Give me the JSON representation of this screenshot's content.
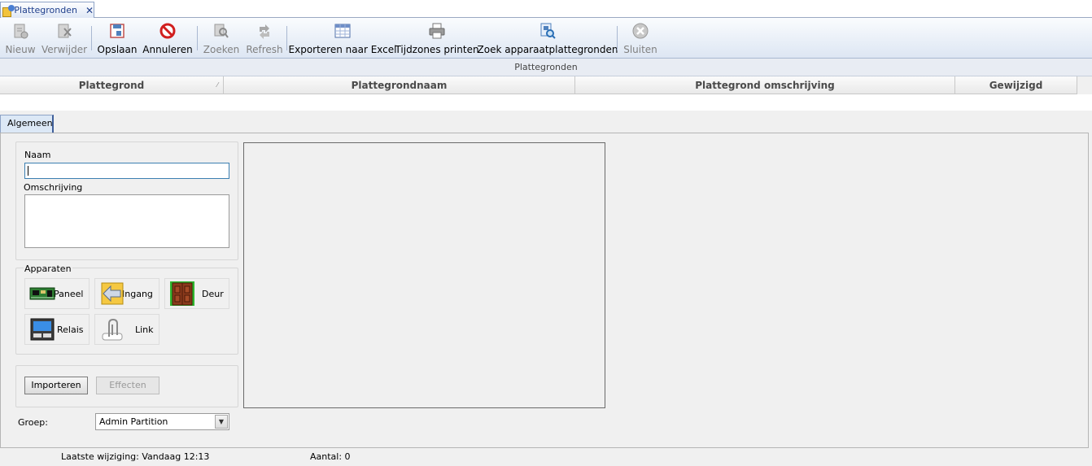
{
  "doc_tab": {
    "title": "Plattegronden"
  },
  "toolbar": {
    "new": "Nieuw",
    "delete": "Verwijder",
    "save": "Opslaan",
    "cancel": "Annuleren",
    "search": "Zoeken",
    "refresh": "Refresh",
    "export": "Exporteren naar Excel",
    "print": "Tijdzones printen",
    "find_device": "Zoek apparaatplattegronden",
    "close": "Sluiten"
  },
  "grid": {
    "caption": "Plattegronden",
    "columns": [
      "Plattegrond",
      "Plattegrondnaam",
      "Plattegrond omschrijving",
      "Gewijzigd"
    ]
  },
  "detail": {
    "tab": "Algemeen",
    "name_label": "Naam",
    "name_value": "",
    "description_label": "Omschrijving",
    "description_value": "",
    "devices_label": "Apparaten",
    "devices": {
      "panel": "Paneel",
      "entrance": "Ingang",
      "door": "Deur",
      "relay": "Relais",
      "link": "Link"
    },
    "import_button": "Importeren",
    "effects_button": "Effecten",
    "group_label": "Groep:",
    "group_value": "Admin Partition"
  },
  "status": {
    "last_change": "Laatste wijziging: Vandaag 12:13",
    "count": "Aantal: 0"
  },
  "colors": {
    "accent": "#1f3f8c",
    "toolbar_gradient_end": "#dde6f3"
  }
}
